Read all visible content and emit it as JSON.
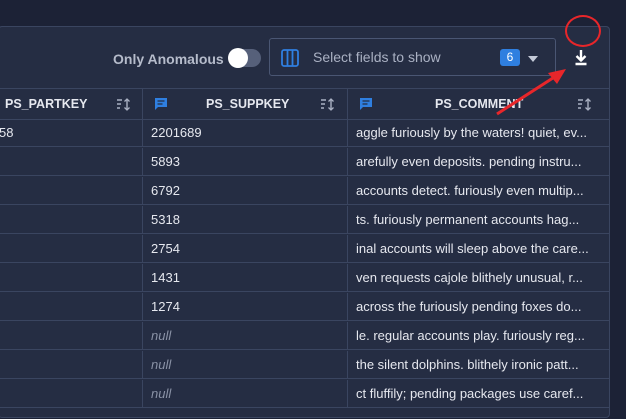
{
  "toolbar": {
    "only_anomalous_label": "Only Anomalous",
    "only_anomalous_on": false,
    "field_select_placeholder": "Select fields to show",
    "field_count": "6",
    "download_icon": "download-icon",
    "accent_color": "#2f7fe0",
    "highlight_color": "#e8262a"
  },
  "table": {
    "columns": [
      {
        "label": "PS_PARTKEY",
        "type_icon": "none",
        "sort_icon": "sort-icon"
      },
      {
        "label": "PS_SUPPKEY",
        "type_icon": "text-field-icon",
        "sort_icon": "sort-icon"
      },
      {
        "label": "PS_COMMENT",
        "type_icon": "text-field-icon",
        "sort_icon": "sort-icon"
      }
    ],
    "rows": [
      [
        "58",
        "2201689",
        "aggle furiously by the waters! quiet, ev..."
      ],
      [
        "",
        "5893",
        "arefully even deposits. pending instru..."
      ],
      [
        "",
        "6792",
        "accounts detect. furiously even multip..."
      ],
      [
        "",
        "5318",
        "ts. furiously permanent accounts hag..."
      ],
      [
        "",
        "2754",
        "inal accounts will sleep above the care..."
      ],
      [
        "",
        "1431",
        "ven requests cajole blithely unusual, r..."
      ],
      [
        "",
        "1274",
        "across the furiously pending foxes do..."
      ],
      [
        "",
        "null",
        "le. regular accounts play. furiously reg..."
      ],
      [
        "",
        "null",
        "the silent dolphins. blithely ironic patt..."
      ],
      [
        "",
        "null",
        "ct fluffily; pending packages use caref..."
      ]
    ]
  }
}
